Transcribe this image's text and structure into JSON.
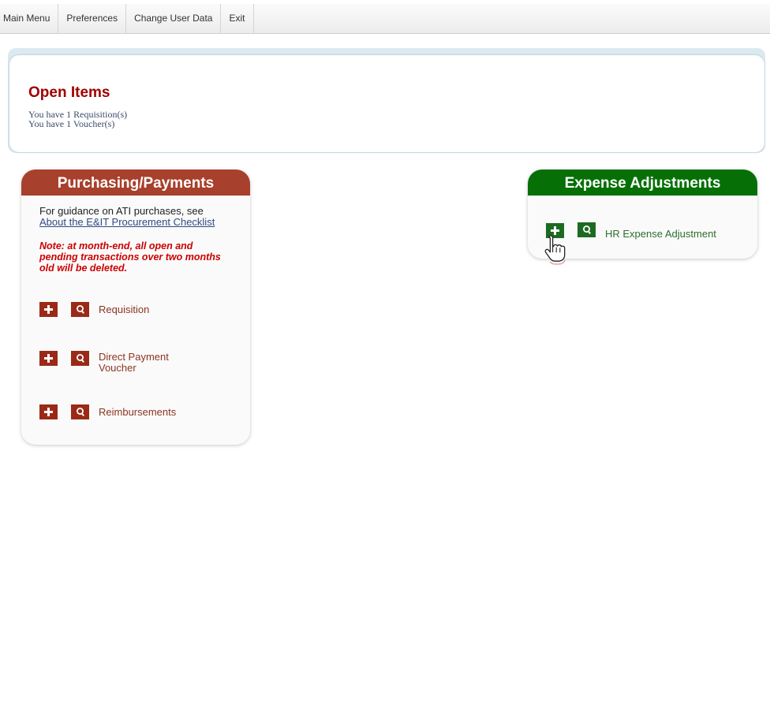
{
  "menu": {
    "items": [
      "Main Menu",
      "Preferences",
      "Change User Data",
      "Exit"
    ]
  },
  "open_items": {
    "title": "Open Items",
    "lines": [
      "You have 1 Requisition(s)",
      "You have 1 Voucher(s)"
    ]
  },
  "purchasing": {
    "title": "Purchasing/Payments",
    "guidance_text": "For guidance on ATI purchases, see",
    "guidance_link": "About the E&IT Procurement Checklist",
    "note": "Note: at month-end, all open and pending transactions over two months old will be deleted.",
    "rows": [
      {
        "label": "Requisition"
      },
      {
        "label": "Direct Payment Voucher"
      },
      {
        "label": "Reimbursements"
      }
    ]
  },
  "expense": {
    "title": "Expense Adjustments",
    "rows": [
      {
        "label": "HR Expense Adjustment"
      }
    ]
  },
  "colors": {
    "purchasing_header": "#a7402c",
    "expense_header": "#067006",
    "open_items_title": "#a00000"
  },
  "icons": {
    "add": "plus-icon",
    "search": "magnifier-icon",
    "cursor": "hand-pointer-cursor"
  }
}
